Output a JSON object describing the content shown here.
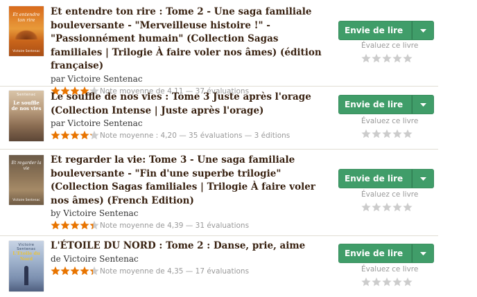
{
  "colors": {
    "accent": "#409d69",
    "star_filled": "#e87400",
    "star_empty": "#cccccc",
    "title": "#382110"
  },
  "books": [
    {
      "title": "Et entendre ton rire : Tome 2 - Une saga familiale bouleversante - \"Merveilleuse histoire !\" - \"Passionnément humain\" (Collection Sagas familiales | Trilogie À faire voler nos âmes) (édition française)",
      "author_prefix": "par",
      "author": "Victoire Sentenac",
      "rating_text": "Note moyenne de 4,11 — 37 évaluations",
      "stars": 4.1,
      "cover_title": "Et entendre ton rire",
      "cover_author": "Victoire Sentenac",
      "want_label": "Envie de lire",
      "rate_label": "Évaluez ce livre"
    },
    {
      "title": "Le souffle de nos vies : Tome 3 Juste après l'orage (Collection Intense | Juste après l'orage)",
      "author_prefix": "par",
      "author": "Victoire Sentenac",
      "rating_text": "Note moyenne : 4,20 — 35 évaluations — 3 éditions",
      "stars": 4.2,
      "cover_title": "Le souffle de nos vies",
      "cover_author": "Sentenac",
      "want_label": "Envie de lire",
      "rate_label": "Évaluez ce livre"
    },
    {
      "title": "Et regarder la vie: Tome 3 - Une saga familiale bouleversante - \"Fin d'une superbe trilogie\" (Collection Sagas familiales | Trilogie À faire voler nos âmes) (French Edition)",
      "author_prefix": "by",
      "author": "Victoire Sentenac",
      "rating_text": "Note moyenne de 4,39 — 31 évaluations",
      "stars": 4.4,
      "cover_title": "Et regarder la vie",
      "cover_author": "Victoire Sentenac",
      "want_label": "Envie de lire",
      "rate_label": "Évaluez ce livre"
    },
    {
      "title": "L'ÉTOILE DU NORD : Tome 2 : Danse, prie, aime",
      "author_prefix": "de",
      "author": "Victoire Sentenac",
      "rating_text": "Note moyenne de 4,35 — 17 évaluations",
      "stars": 4.35,
      "cover_title": "L'Étoile du Nord",
      "cover_author": "Victoire Sentenac",
      "want_label": "Envie de lire",
      "rate_label": "Évaluez ce livre"
    }
  ]
}
